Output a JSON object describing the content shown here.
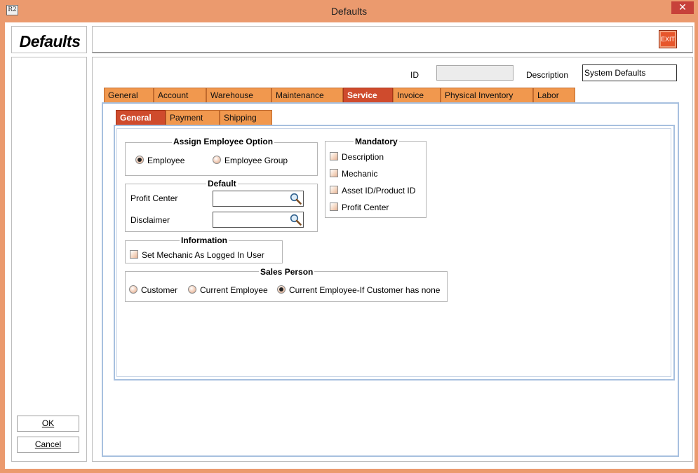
{
  "window": {
    "title": "Defaults",
    "app_icon": "R2",
    "close_glyph": "✕"
  },
  "heading": "Defaults",
  "toolbar": {
    "exit_label": "EXIT"
  },
  "header_fields": {
    "id_label": "ID",
    "id_value": "",
    "description_label": "Description",
    "description_value": "System Defaults"
  },
  "tabs": [
    {
      "label": "General",
      "active": false
    },
    {
      "label": "Account",
      "active": false
    },
    {
      "label": "Warehouse",
      "active": false
    },
    {
      "label": "Maintenance",
      "active": false
    },
    {
      "label": "Service",
      "active": true
    },
    {
      "label": "Invoice",
      "active": false
    },
    {
      "label": "Physical Inventory",
      "active": false
    },
    {
      "label": "Labor",
      "active": false
    }
  ],
  "subtabs": [
    {
      "label": "General",
      "active": true
    },
    {
      "label": "Payment",
      "active": false
    },
    {
      "label": "Shipping",
      "active": false
    }
  ],
  "assign_employee": {
    "title": "Assign Employee Option",
    "options": [
      {
        "label": "Employee",
        "checked": true
      },
      {
        "label": "Employee Group",
        "checked": false
      }
    ]
  },
  "default_group": {
    "title": "Default",
    "profit_center_label": "Profit Center",
    "profit_center_value": "",
    "disclaimer_label": "Disclaimer",
    "disclaimer_value": ""
  },
  "information": {
    "title": "Information",
    "set_mechanic_label": "Set Mechanic As Logged In User",
    "set_mechanic_checked": false
  },
  "sales_person": {
    "title": "Sales Person",
    "options": [
      {
        "label": "Customer",
        "checked": false
      },
      {
        "label": "Current Employee",
        "checked": false
      },
      {
        "label": "Current Employee-If Customer has none",
        "checked": true
      }
    ]
  },
  "mandatory": {
    "title": "Mandatory",
    "items": [
      {
        "label": "Description",
        "checked": false
      },
      {
        "label": "Mechanic",
        "checked": false
      },
      {
        "label": "Asset ID/Product ID",
        "checked": false
      },
      {
        "label": "Profit Center",
        "checked": false
      }
    ]
  },
  "buttons": {
    "ok": "OK",
    "cancel": "Cancel"
  },
  "colors": {
    "chrome": "#eb9a6e",
    "tab": "#f1984e",
    "tab_active": "#cf4b2d",
    "panel_border": "#a7c0df",
    "close": "#c7413a",
    "exit": "#e7562b"
  }
}
